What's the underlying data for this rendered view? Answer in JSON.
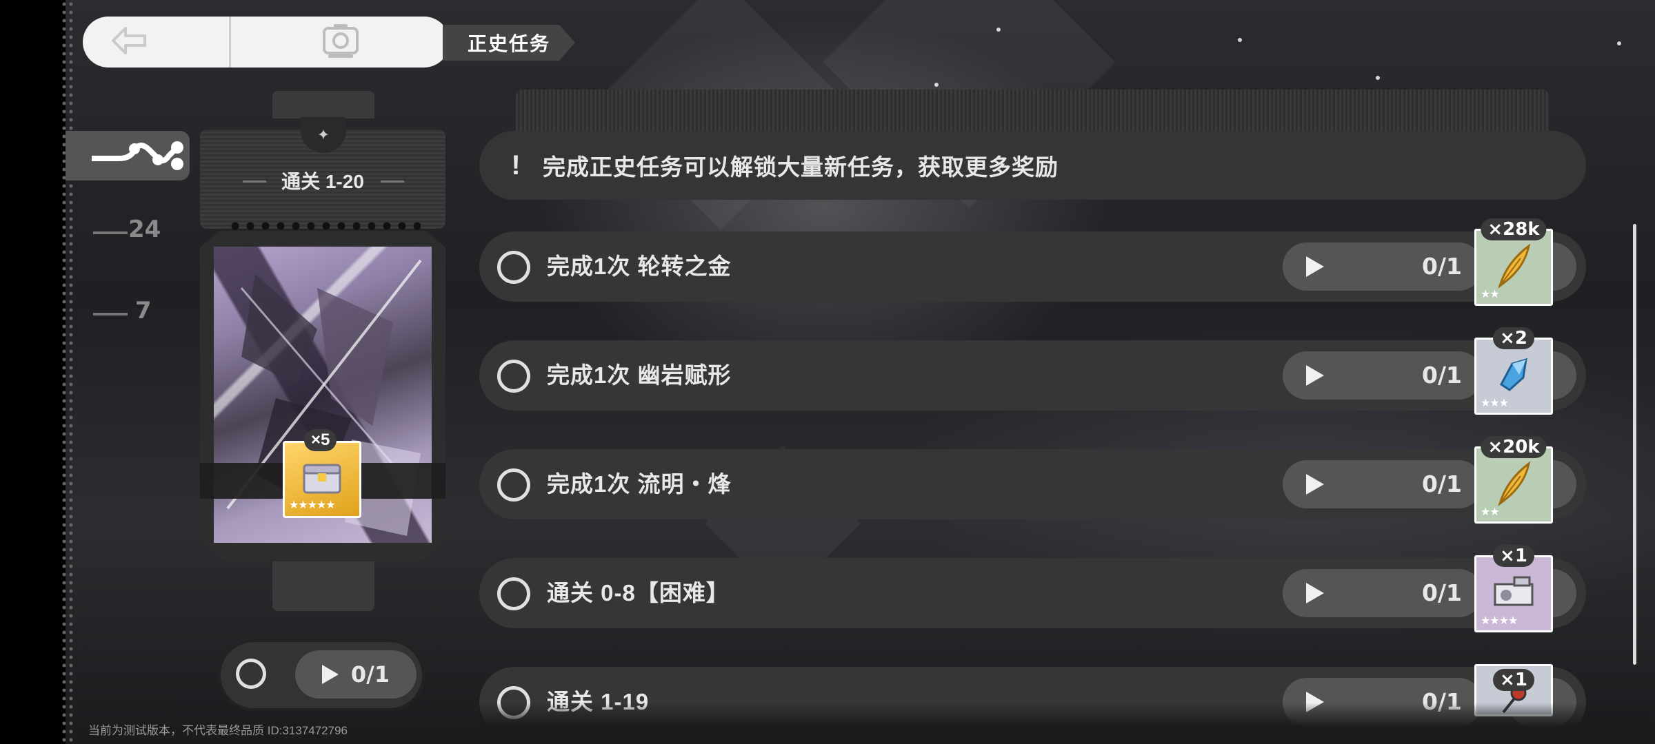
{
  "header": {
    "title": "正史任务",
    "back_icon": "arrow-left-icon",
    "camera_icon": "camera-icon"
  },
  "nav": {
    "active_icon": "route-nodes-icon",
    "items": [
      {
        "label": "24"
      },
      {
        "label": "7"
      }
    ]
  },
  "reward_card": {
    "title": "通关 1-20",
    "item_qty": "×5",
    "item_stars": "★★★★★",
    "progress": "0/1"
  },
  "tip": {
    "text": "完成正史任务可以解锁大量新任务，获取更多奖励"
  },
  "tasks": [
    {
      "label": "完成1次 轮转之金",
      "progress": "0/1",
      "reward_qty": "×28k",
      "reward_icon": "gold-feather-icon",
      "reward_stars": "★★",
      "reward_bg": "#b8cdb4"
    },
    {
      "label": "完成1次 幽岩赋形",
      "progress": "0/1",
      "reward_qty": "×2",
      "reward_icon": "blue-crystal-icon",
      "reward_stars": "★★★",
      "reward_bg": "#c6cbd6"
    },
    {
      "label": "完成1次 流明・烽",
      "progress": "0/1",
      "reward_qty": "×20k",
      "reward_icon": "gold-feather-icon",
      "reward_stars": "★★",
      "reward_bg": "#b8cdb4"
    },
    {
      "label": "通关 0-8【困难】",
      "progress": "0/1",
      "reward_qty": "×1",
      "reward_icon": "mechanism-icon",
      "reward_stars": "★★★★",
      "reward_bg": "#cbb8d6"
    },
    {
      "label": "通关 1-19",
      "progress": "0/1",
      "reward_qty": "×1",
      "reward_icon": "key-icon",
      "reward_stars": "",
      "reward_bg": "#c6cbd6"
    }
  ],
  "footer": {
    "watermark": "当前为测试版本，不代表最终品质 ID:3137472796"
  }
}
